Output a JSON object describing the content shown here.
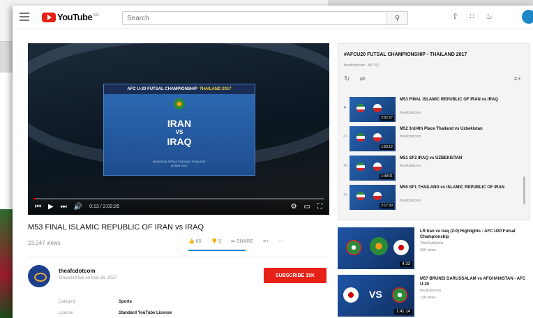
{
  "header": {
    "logo_text": "YouTube",
    "logo_sup": "SG",
    "search_placeholder": "Search",
    "search_icon": "search-icon",
    "icons": [
      "upload-icon",
      "apps-icon",
      "bell-icon"
    ]
  },
  "player": {
    "card_header": "AFC U-20 FUTSAL CHAMPIONSHIP",
    "card_header_highlight": "THAILAND 2017",
    "team1": "IRAN",
    "vs": "VS",
    "team2": "IRAQ",
    "card_foot1": "BANGKOK ARENA STADIUM, THAILAND",
    "card_foot2": "20 MAY 2017",
    "time": "0:13 / 2:02:26",
    "progress": 0.01
  },
  "video": {
    "title": "M53 FINAL ISLAMIC REPUBLIC OF IRAN vs IRAQ",
    "views": "23,247 views",
    "likes": "65",
    "dislikes": "5",
    "share": "SHARE"
  },
  "channel": {
    "name": "theafcdotcom",
    "date": "Streamed live on May 26, 2017",
    "subscribe": "SUBSCRIBE 15K",
    "meta": [
      {
        "label": "Category",
        "value": "Sports"
      },
      {
        "label": "License",
        "value": "Standard YouTube License"
      }
    ]
  },
  "playlist": {
    "title": "#AFCU20 FUTSAL CHAMPIONSHIP - THAILAND 2017",
    "subtitle": "theafcdotcom · 46 / 53",
    "items": [
      {
        "idx": "▶",
        "title": "M53 FINAL ISLAMIC REPUBLIC OF IRAN vs IRAQ",
        "channel": "theafcdotcom",
        "duration": "2:02:27"
      },
      {
        "idx": "47",
        "title": "M52 3rd/4th Place Thailand vs Uzbekistan",
        "channel": "theafcdotcom",
        "duration": "1:50:12"
      },
      {
        "idx": "48",
        "title": "M51 SF2 IRAQ vs UZBEKISTAN",
        "channel": "theafcdotcom",
        "duration": "1:49:01"
      },
      {
        "idx": "49",
        "title": "M50 SF1 THAILAND vs ISLAMIC REPUBLIC OF IRAN",
        "channel": "theafcdotcom",
        "duration": "2:17:30"
      }
    ]
  },
  "recommended": [
    {
      "title": "LR Iran vs Iraq (2-0) Highlights : AFC U20 Futsal Championship",
      "channel": "TimeOutSports",
      "views": "30K views",
      "duration": "4:33"
    },
    {
      "title": "M57 BRUNEI DARUSSALAM vs AFGHANISTAN - AFC U-20",
      "channel": "theafcdotcom",
      "views": "13K views",
      "duration": "1:41:14"
    }
  ]
}
